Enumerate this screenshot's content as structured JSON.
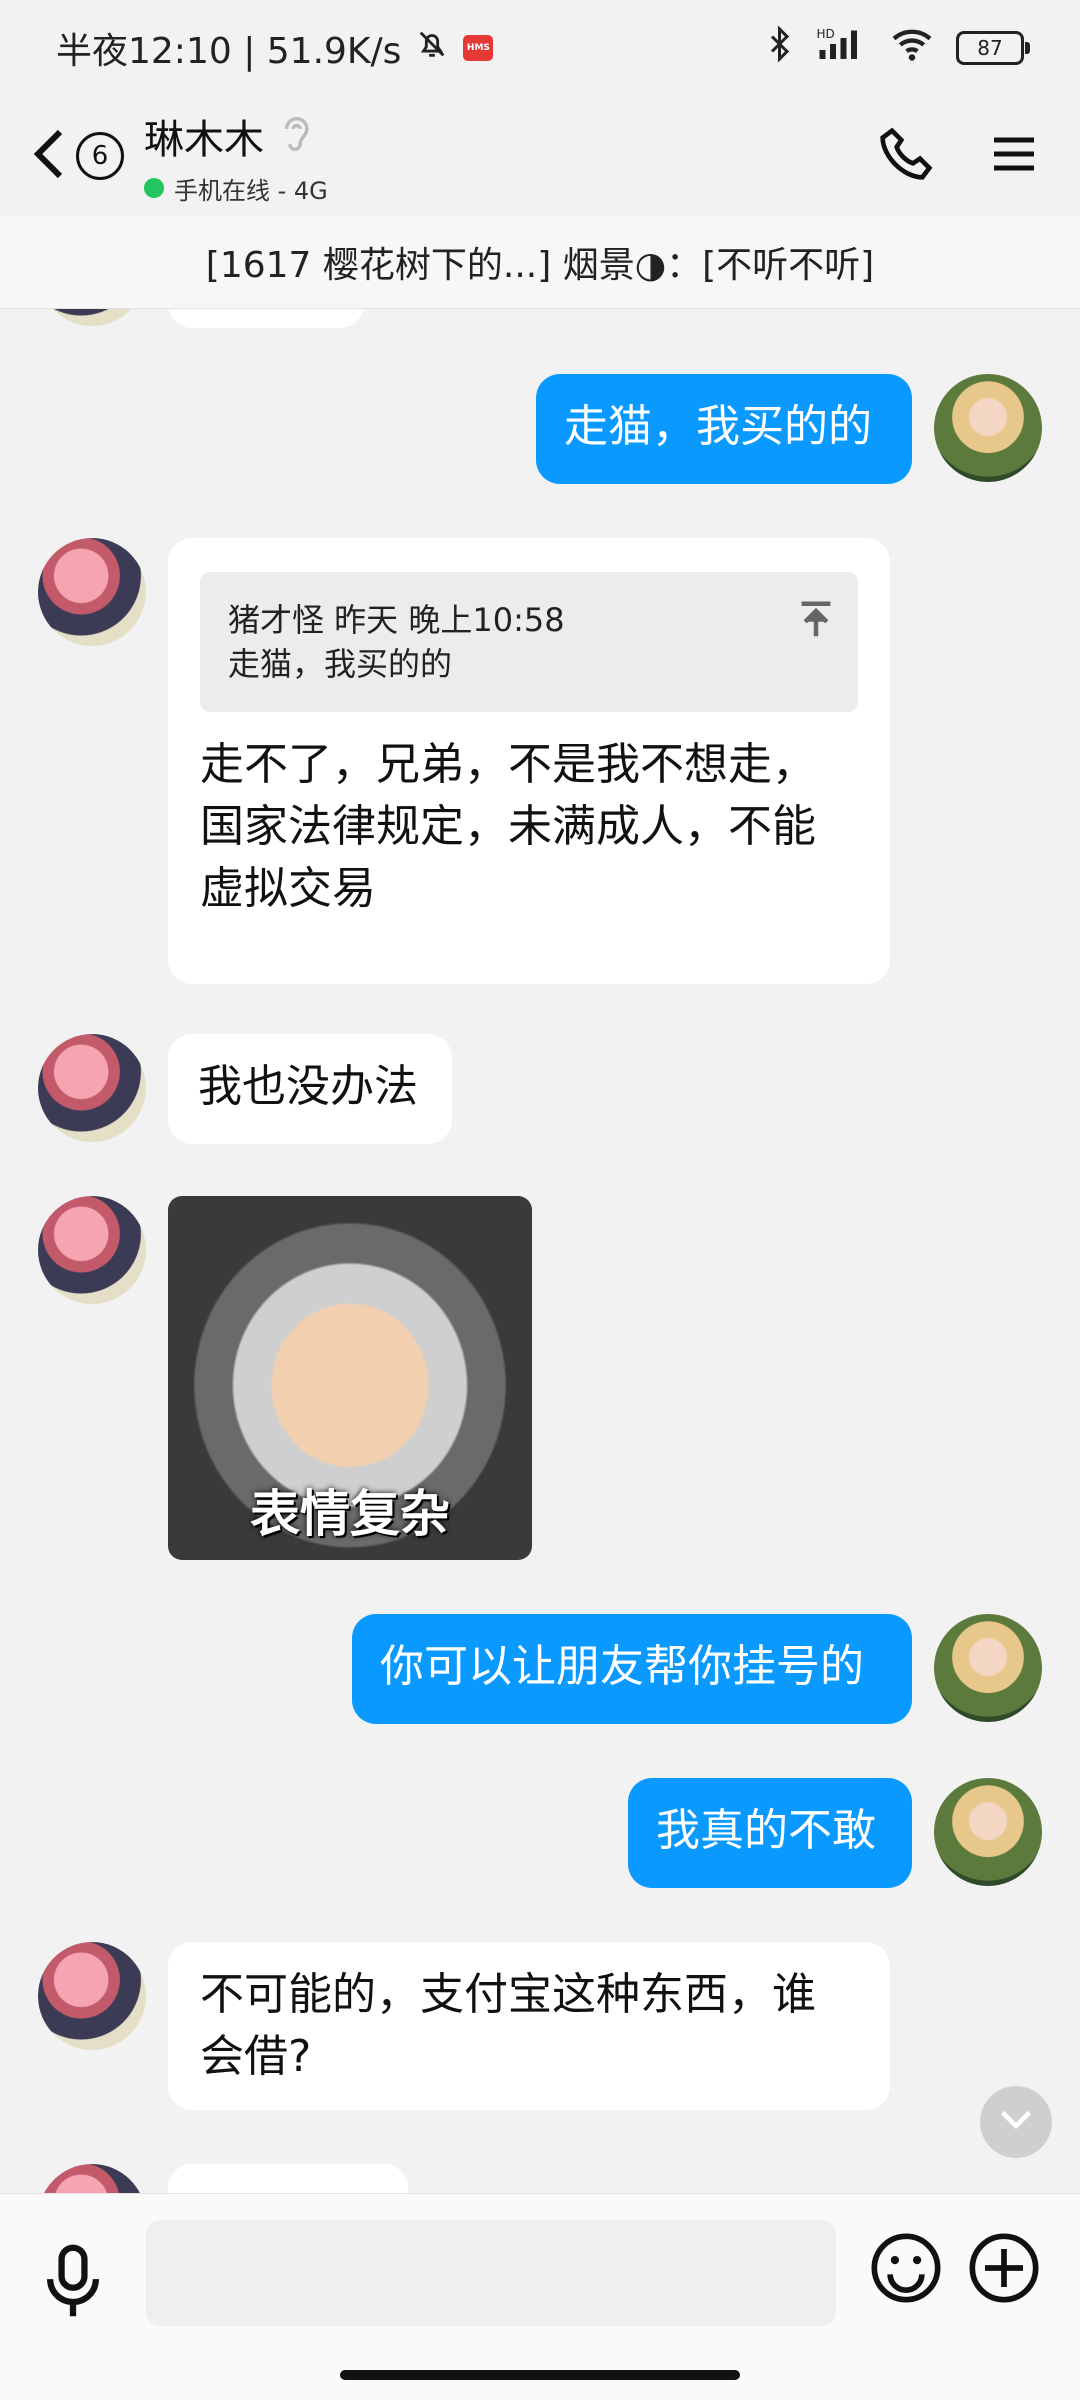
{
  "status_bar": {
    "time_text": "半夜12:10 | 51.9K/s",
    "icons": [
      "bell-off-icon",
      "hms-badge-icon",
      "bluetooth-icon",
      "hd-signal-icon",
      "wifi-icon"
    ],
    "battery": "87"
  },
  "header": {
    "back_icon": "chevron-left-icon",
    "unread_count": "6",
    "contact_name": "琳木木",
    "presence": "手机在线 - 4G",
    "actions": [
      "phone-icon",
      "menu-icon"
    ]
  },
  "pinned": {
    "text": "[1617 樱花树下的...] 烟景◑：[不听不听]"
  },
  "messages": [
    {
      "side": "me",
      "text": "走猫，我买的的"
    },
    {
      "side": "them",
      "quote": {
        "author_time": "猪才怪 昨天 晚上10:58",
        "text": "走猫，我买的的"
      },
      "line1": "走不了，兄弟，不是我不想走，",
      "line2": "国家法律规定，未满成人，不能",
      "line3": "虚拟交易"
    },
    {
      "side": "them",
      "text": "我也没办法"
    },
    {
      "side": "them",
      "sticker_caption": "表情复杂"
    },
    {
      "side": "me",
      "text": "你可以让朋友帮你挂号的"
    },
    {
      "side": "me",
      "text": "我真的不敢"
    },
    {
      "side": "them",
      "line1": "不可能的，支付宝这种东西，谁",
      "line2": "会借?"
    }
  ],
  "input_bar": {
    "placeholder": "",
    "icons": [
      "microphone-icon",
      "emoji-icon",
      "plus-icon"
    ]
  },
  "colors": {
    "accent_blue": "#0a99ff",
    "background": "#f2f2f2",
    "bubble_white": "#ffffff",
    "online_green": "#22c55e"
  }
}
